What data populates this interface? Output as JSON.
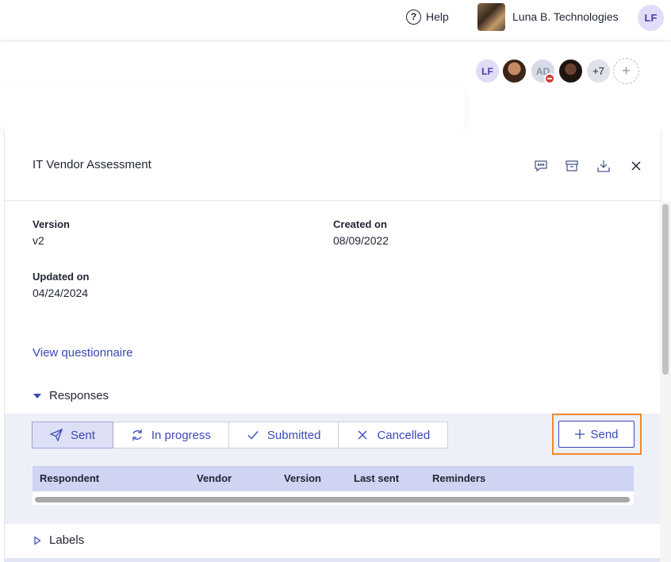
{
  "topbar": {
    "help_label": "Help",
    "org_name": "Luna B. Technologies",
    "user_initials": "LF"
  },
  "collaborators": {
    "first_initials": "LF",
    "blocked_initials": "AD",
    "more_count": "+7",
    "add_symbol": "+"
  },
  "panel": {
    "title": "IT Vendor Assessment",
    "fields": {
      "version_label": "Version",
      "version_value": "v2",
      "created_label": "Created on",
      "created_value": "08/09/2022",
      "updated_label": "Updated on",
      "updated_value": "04/24/2024"
    },
    "view_link": "View questionnaire",
    "responses_label": "Responses",
    "labels_label": "Labels"
  },
  "responses": {
    "tabs": [
      {
        "label": "Sent",
        "icon": "paper-plane-icon",
        "active": true
      },
      {
        "label": "In progress",
        "icon": "refresh-icon",
        "active": false
      },
      {
        "label": "Submitted",
        "icon": "check-icon",
        "active": false
      },
      {
        "label": "Cancelled",
        "icon": "x-icon",
        "active": false
      }
    ],
    "send_label": "Send",
    "columns": [
      "Respondent",
      "Vendor",
      "Version",
      "Last sent",
      "Reminders"
    ]
  },
  "colors": {
    "accent": "#3b49b8",
    "highlight": "#f0892a",
    "table_header": "#cfd4f2"
  }
}
